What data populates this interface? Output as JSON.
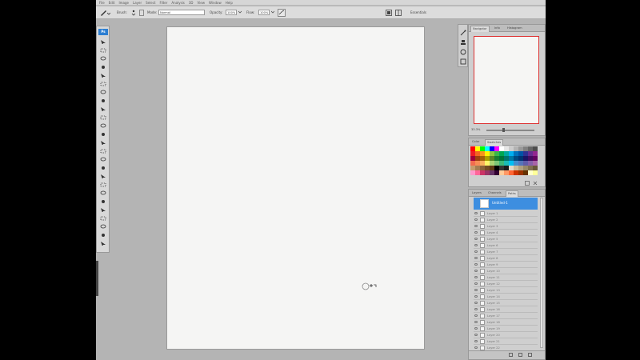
{
  "menu": [
    "File",
    "Edit",
    "Image",
    "Layer",
    "Select",
    "Filter",
    "Analysis",
    "3D",
    "View",
    "Window",
    "Help"
  ],
  "options": {
    "brush_label": "Brush:",
    "mode_label": "Mode:",
    "mode_value": "Normal",
    "opacity_label": "Opacity:",
    "opacity_value": "100%",
    "flow_label": "Flow:",
    "flow_value": "100%",
    "workspace": "Essentials"
  },
  "toolbox": {
    "logo": "Ps",
    "tools": [
      "move",
      "marquee",
      "lasso",
      "quick-select",
      "crop",
      "eyedropper",
      "healing",
      "brush",
      "clone-stamp",
      "history-brush",
      "eraser",
      "gradient",
      "blur",
      "dodge",
      "pen",
      "type",
      "path-select",
      "shape",
      "3d-rotate",
      "3d-orbit",
      "hand",
      "zoom",
      "color-swatches",
      "quick-mask",
      "screen-mode"
    ]
  },
  "navigator": {
    "tabs": [
      "Navigator",
      "Info",
      "Histogram"
    ],
    "zoom": "33.3%"
  },
  "swatches_panel": {
    "tabs": [
      "Color",
      "Swatches"
    ],
    "colors": [
      "#ff0000",
      "#ffff00",
      "#00ff00",
      "#00ffff",
      "#0000ff",
      "#ff00ff",
      "#ffffff",
      "#e6e6e6",
      "#cccccc",
      "#b3b3b3",
      "#999999",
      "#808080",
      "#666666",
      "#4d4d4d",
      "#ed1c24",
      "#f26522",
      "#f7941d",
      "#fff200",
      "#8dc63f",
      "#39b54a",
      "#00a651",
      "#00a99d",
      "#00aeef",
      "#0072bc",
      "#0054a6",
      "#2e3192",
      "#662d91",
      "#92278f",
      "#9e0039",
      "#a0410d",
      "#a36209",
      "#aba000",
      "#598527",
      "#197b30",
      "#007236",
      "#00746b",
      "#0076a3",
      "#004a80",
      "#003471",
      "#1b1464",
      "#440e62",
      "#630460",
      "#f26c4f",
      "#f68e56",
      "#fbaf5d",
      "#fff568",
      "#acd373",
      "#7cc576",
      "#3cb878",
      "#1cbbb4",
      "#00bff3",
      "#448ccb",
      "#5574b9",
      "#605ca8",
      "#8560a8",
      "#a864a8",
      "#c69c6d",
      "#a67c52",
      "#8c6239",
      "#754c24",
      "#603913",
      "#000000",
      "#333333",
      "#1a1a1a",
      "#e0d8c8",
      "#c8b89a",
      "#b0a080",
      "#988868",
      "#807050",
      "#685838",
      "#ff99cc",
      "#ff6699",
      "#cc3366",
      "#993366",
      "#663366",
      "#330033",
      "#ffcc99",
      "#ff9966",
      "#ff6633",
      "#cc3300",
      "#993300",
      "#663300",
      "#ffffcc",
      "#ffff99"
    ]
  },
  "layers_panel": {
    "tabs": [
      "Layers",
      "Channels",
      "Paths"
    ],
    "active_layer": "Untitled-1",
    "layers": [
      "Layer 1",
      "Layer 2",
      "Layer 3",
      "Layer 4",
      "Layer 5",
      "Layer 6",
      "Layer 7",
      "Layer 8",
      "Layer 9",
      "Layer 10",
      "Layer 11",
      "Layer 12",
      "Layer 13",
      "Layer 14",
      "Layer 15",
      "Layer 16",
      "Layer 17",
      "Layer 18",
      "Layer 19",
      "Layer 20",
      "Layer 21",
      "Layer 22"
    ]
  }
}
